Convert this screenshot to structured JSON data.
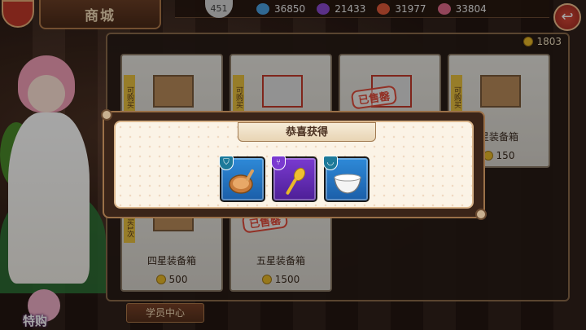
{
  "header": {
    "title": "商城",
    "level": "451",
    "back_symbol": "↩"
  },
  "resources": [
    {
      "icon": "potion-icon",
      "color": "#4aa0e0",
      "value": "36850"
    },
    {
      "icon": "gem-icon",
      "color": "#8a4ad0",
      "value": "21433"
    },
    {
      "icon": "food-icon",
      "color": "#e05a3a",
      "value": "31977"
    },
    {
      "icon": "cake-icon",
      "color": "#e06a8a",
      "value": "33804"
    }
  ],
  "shop": {
    "coin_balance": "1803",
    "cards": [
      {
        "name": "四星装备箱",
        "price": "500",
        "tag": "可购买1次",
        "sold_label": ""
      },
      {
        "name": "五星装备箱",
        "price": "1500",
        "tag": "",
        "sold_label": "已售罄"
      },
      {
        "name": "",
        "price": "",
        "tag": "",
        "sold_label": "已售罄"
      },
      {
        "name": "星装备箱",
        "price": "150",
        "tag": "可购买",
        "sold_label": ""
      }
    ],
    "top_tags": [
      "可购买",
      "可购买"
    ]
  },
  "footer": {
    "student_center": "学员中心",
    "special_buy": "特购"
  },
  "dialog": {
    "title": "恭喜获得",
    "items": [
      {
        "name": "frying-pan",
        "rarity": "blue",
        "type_icon": "utensil-icon"
      },
      {
        "name": "golden-spoon",
        "rarity": "purple",
        "type_icon": "fork-icon"
      },
      {
        "name": "white-bowl",
        "rarity": "blue",
        "type_icon": "bowl-icon"
      }
    ]
  }
}
